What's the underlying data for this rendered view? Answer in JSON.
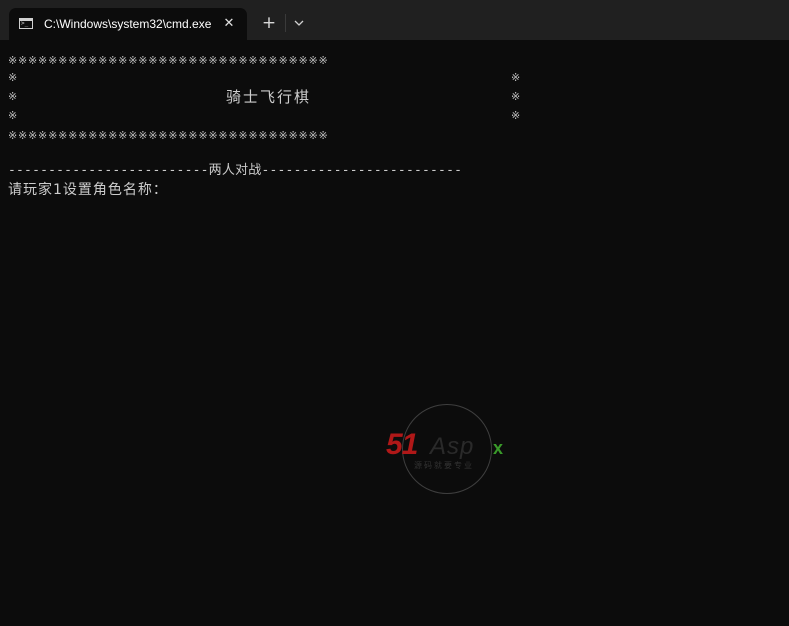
{
  "window": {
    "tab_title": "C:\\Windows\\system32\\cmd.exe",
    "close_glyph": "✕",
    "new_tab_glyph": "+",
    "icons": [
      "cmd-icon",
      "close-icon",
      "plus-icon",
      "chevron-down-icon"
    ]
  },
  "console": {
    "border_line": "※※※※※※※※※※※※※※※※※※※※※※※※※※※※※※※※",
    "side_mark": "※",
    "game_title": "骑士飞行棋",
    "mode_line": "-------------------------两人对战-------------------------",
    "prompt": "请玩家1设置角色名称："
  },
  "watermark": {
    "brand_num": "51",
    "brand_text": "Asp",
    "brand_x": "x",
    "subtitle": "源码就要专业"
  },
  "colors": {
    "background": "#0c0c0c",
    "titlebar": "#202020",
    "text": "#cccccc",
    "brand_red": "#b01818",
    "brand_green": "#3a9a2a"
  }
}
